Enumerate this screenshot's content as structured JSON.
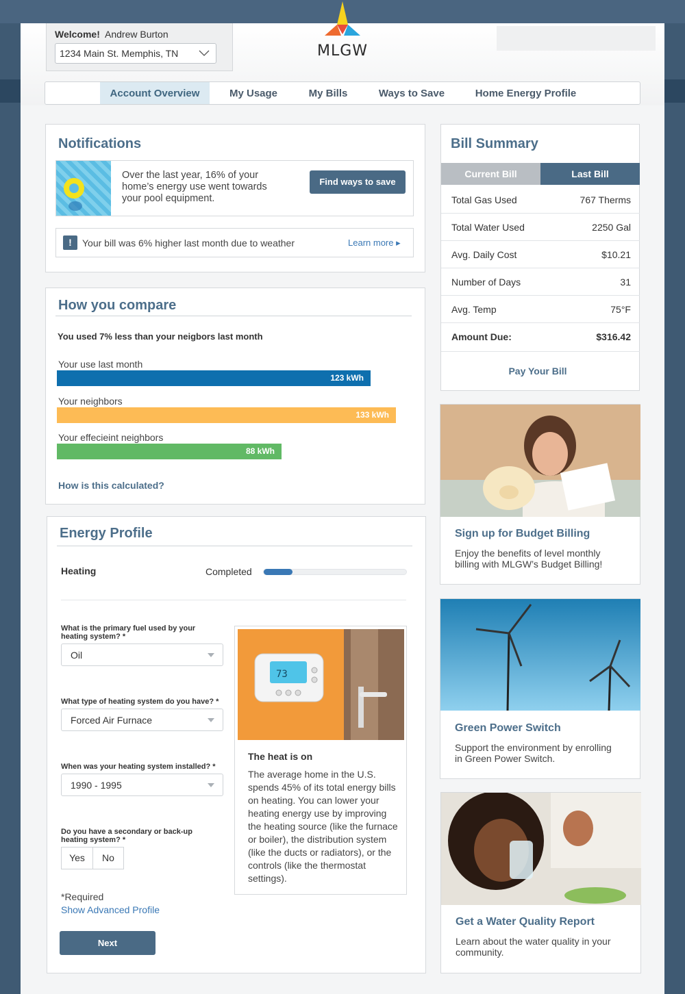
{
  "header": {
    "welcome_label": "Welcome!",
    "user_name": "Andrew Burton",
    "address": "1234 Main St. Memphis, TN",
    "logo_text": "MLGW"
  },
  "nav": {
    "tabs": [
      {
        "label": "Account Overview",
        "active": true
      },
      {
        "label": "My Usage"
      },
      {
        "label": "My Bills"
      },
      {
        "label": "Ways to Save"
      },
      {
        "label": "Home Energy Profile"
      }
    ]
  },
  "notifications": {
    "title": "Notifications",
    "pool_message": "Over the last year, 16% of your home’s energy use went towards your pool equipment.",
    "pool_button": "Find ways to save",
    "weather_icon": "!",
    "weather_message": "Your bill was 6% higher last month due to weather",
    "learn_more": "Learn more ▸"
  },
  "compare": {
    "title": "How you compare",
    "summary": "You used 7% less than your neigbors last month",
    "bars": [
      {
        "label": "Your use last month",
        "value_text": "123 kWh",
        "value": 123,
        "color": "#0e6fae"
      },
      {
        "label": "Your neighbors",
        "value_text": "133 kWh",
        "value": 133,
        "color": "#fdbb55"
      },
      {
        "label": "Your effecieint neighbors",
        "value_text": "88 kWh",
        "value": 88,
        "color": "#61b965"
      }
    ],
    "calc_link": "How is this calculated?"
  },
  "energy_profile": {
    "title": "Energy Profile",
    "section": "Heating",
    "status_label": "Completed",
    "progress": 0.2,
    "q1_label": "What is the primary fuel used by your heating system? *",
    "q1_value": "Oil",
    "q2_label": "What type of heating system do you have? *",
    "q2_value": "Forced Air Furnace",
    "q3_label": "When was your heating system installed? *",
    "q3_value": "1990 - 1995",
    "q4_label": "Do you have a secondary or back-up heating system? *",
    "q4_yes": "Yes",
    "q4_no": "No",
    "required_note": "*Required",
    "advanced_link": "Show Advanced Profile",
    "next_button": "Next",
    "info_title": "The heat is on",
    "info_text": "The average home in the U.S. spends 45% of its total energy bills on heating. You can lower your heating energy use by improving the heating source (like the furnace or boiler), the distribution system (like the ducts or radiators), or the controls (like the thermostat settings).",
    "thermostat_display": "73"
  },
  "bill_summary": {
    "title": "Bill Summary",
    "tab_current": "Current Bill",
    "tab_last": "Last Bill",
    "rows": [
      {
        "k": "Total Gas Used",
        "v": "767 Therms"
      },
      {
        "k": "Total Water Used",
        "v": "2250 Gal"
      },
      {
        "k": "Avg. Daily Cost",
        "v": "$10.21"
      },
      {
        "k": "Number of Days",
        "v": "31"
      },
      {
        "k": "Avg. Temp",
        "v": "75°F"
      },
      {
        "k": "Amount Due:",
        "v": "$316.42"
      }
    ],
    "pay_link": "Pay Your Bill"
  },
  "promos": [
    {
      "title": "Sign up for Budget Billing",
      "text": "Enjoy the benefits of level monthly billing with MLGW’s Budget Billing!"
    },
    {
      "title": "Green Power Switch",
      "text": "Support the environment by enrolling in Green Power Switch."
    },
    {
      "title": "Get a Water Quality Report",
      "text": "Learn about the water quality in your community."
    }
  ]
}
